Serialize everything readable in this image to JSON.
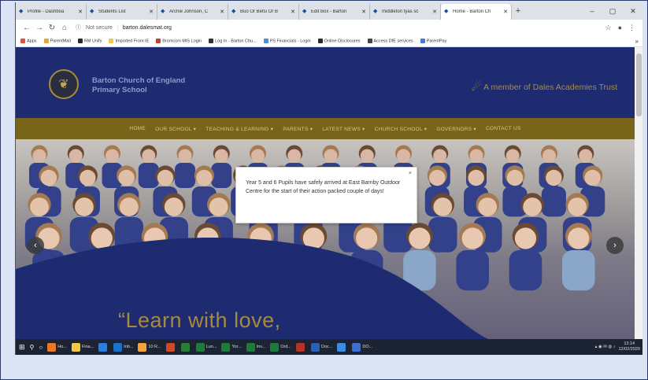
{
  "browser": {
    "tabs": [
      {
        "label": "Profile - Dashboa",
        "active": false
      },
      {
        "label": "Students List",
        "active": false
      },
      {
        "label": "Archie Johnson, C",
        "active": false
      },
      {
        "label": "Buo Or Betsi Or B",
        "active": false
      },
      {
        "label": "Edit Box - Barton",
        "active": false
      },
      {
        "label": "middleton tyas sc",
        "active": false
      },
      {
        "label": "Home - Barton Ch",
        "active": true
      }
    ],
    "new_tab": "+",
    "window_controls": [
      "–",
      "▢",
      "✕"
    ],
    "security_label": "Not secure",
    "url": "barton.dalesmat.org",
    "bookmarks": [
      {
        "label": "Apps",
        "color": "#e0533d"
      },
      {
        "label": "ParentMail",
        "color": "#e8a23a"
      },
      {
        "label": "RM Unify",
        "color": "#2a2a2a"
      },
      {
        "label": "Imported From IE",
        "color": "#f2c744"
      },
      {
        "label": "Bromcom MIS Login",
        "color": "#c6412f"
      },
      {
        "label": "Log In - Barton Chu...",
        "color": "#333333"
      },
      {
        "label": "PS Financials - Login",
        "color": "#4a8fd6"
      },
      {
        "label": "Online Disclosures",
        "color": "#2b2b2b"
      },
      {
        "label": "Access DfE services",
        "color": "#444444"
      },
      {
        "label": "ParentPay",
        "color": "#3d7fd0"
      }
    ],
    "bookmarks_overflow": "»"
  },
  "site": {
    "school_name_line1": "Barton Church of England",
    "school_name_line2": "Primary School",
    "trust_text": "A member of Dales Academies Trust",
    "nav_items": [
      "HOME",
      "OUR SCHOOL ▾",
      "TEACHING & LEARNING ▾",
      "PARENTS ▾",
      "LATEST NEWS ▾",
      "CHURCH SCHOOL ▾",
      "GOVERNORS ▾",
      "CONTACT US"
    ],
    "tagline": "“Learn with love,",
    "popup_text": "Year 5 and 6 Pupils have safely arrived at East Barnby Outdoor Centre for the start of their action packed couple of days!",
    "popup_close": "×",
    "prev_arrow": "‹",
    "next_arrow": "›"
  },
  "taskbar": {
    "items": [
      {
        "label": "Ho...",
        "color": "#e8792b"
      },
      {
        "label": "Fina...",
        "color": "#f2c744"
      },
      {
        "label": "",
        "color": "#2c7de0"
      },
      {
        "label": "Inb...",
        "color": "#1e6fc9"
      },
      {
        "label": "10 R...",
        "color": "#f2a43a"
      },
      {
        "label": "",
        "color": "#d24726"
      },
      {
        "label": "",
        "color": "#2c7d3a"
      },
      {
        "label": "Lun...",
        "color": "#1f7a3d"
      },
      {
        "label": "Yor...",
        "color": "#1f7a3d"
      },
      {
        "label": "Inv...",
        "color": "#1f7a3d"
      },
      {
        "label": "Ord...",
        "color": "#1f7a3d"
      },
      {
        "label": "",
        "color": "#b7312b"
      },
      {
        "label": "Doc...",
        "color": "#2b5fb8"
      },
      {
        "label": "",
        "color": "#3b8de0"
      },
      {
        "label": "DO...",
        "color": "#3b6fd0"
      }
    ],
    "time": "13:14",
    "date": "12/02/2020"
  }
}
